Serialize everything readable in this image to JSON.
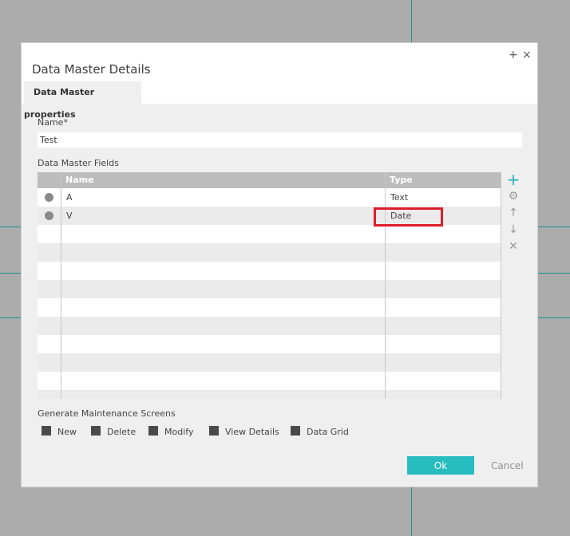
{
  "dialog": {
    "title": "Data Master Details",
    "add_symbol": "+",
    "close_symbol": "×"
  },
  "tabs": [
    {
      "label": "Data Master properties"
    }
  ],
  "form": {
    "name_label": "Name*",
    "name_value": "Test",
    "fields_label": "Data Master Fields"
  },
  "grid": {
    "columns": {
      "name": "Name",
      "type": "Type"
    },
    "rows": [
      {
        "name": "A",
        "type": "Text"
      },
      {
        "name": "V",
        "type": "Date"
      }
    ]
  },
  "side_buttons": {
    "add": "+",
    "settings": "⚙",
    "up": "↑",
    "down": "↓",
    "delete": "✕"
  },
  "maintenance": {
    "label": "Generate Maintenance Screens",
    "options": [
      "New",
      "Delete",
      "Modify",
      "View Details",
      "Data Grid"
    ]
  },
  "actions": {
    "ok": "Ok",
    "cancel": "Cancel"
  },
  "colors": {
    "accent": "#26bcc0",
    "highlight": "#dd1e2a"
  }
}
